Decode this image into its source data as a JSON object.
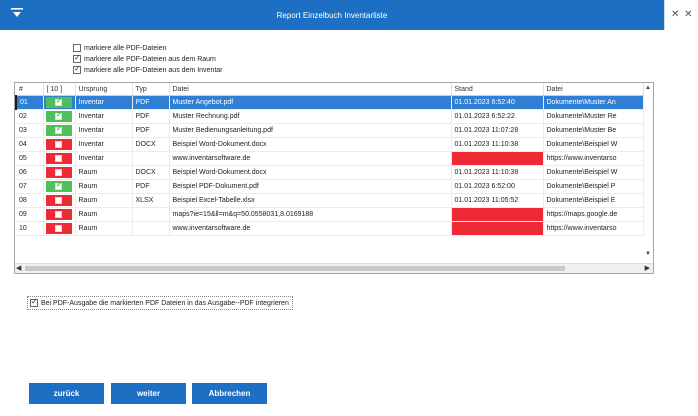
{
  "window": {
    "title": "Report Einzelbuch Inventarliste",
    "close_glyphs": "✕ ✕"
  },
  "options": {
    "mark_all_pdf": "markiere alle PDF-Dateien",
    "mark_all_pdf_room": "markiere alle PDF-Dateien aus dem Raum",
    "mark_all_pdf_inventory": "markiere alle PDF-Dateien aus dem Inventar"
  },
  "table": {
    "columns": [
      "#",
      "[ 10 ]",
      "Ursprung",
      "Typ",
      "Datei",
      "Stand",
      "Datei"
    ],
    "rows": [
      {
        "num": "01",
        "checked": true,
        "ursprung": "Inventar",
        "typ": "PDF",
        "datei": "Muster Angebot.pdf",
        "stand": "01.01.2023  6:52:40",
        "stand_missing": false,
        "pfad": "Dokumente\\Muster An"
      },
      {
        "num": "02",
        "checked": true,
        "ursprung": "Inventar",
        "typ": "PDF",
        "datei": "Muster Rechnung.pdf",
        "stand": "01.01.2023  6:52:22",
        "stand_missing": false,
        "pfad": "Dokumente\\Muster Re"
      },
      {
        "num": "03",
        "checked": true,
        "ursprung": "Inventar",
        "typ": "PDF",
        "datei": "Muster Bedienungsanleitung.pdf",
        "stand": "01.01.2023 11:07:28",
        "stand_missing": false,
        "pfad": "Dokumente\\Muster Be"
      },
      {
        "num": "04",
        "checked": false,
        "ursprung": "Inventar",
        "typ": "DOCX",
        "datei": "Beispiel Word-Dokument.docx",
        "stand": "01.01.2023 11:10:38",
        "stand_missing": false,
        "pfad": "Dokumente\\Beispiel W"
      },
      {
        "num": "05",
        "checked": false,
        "ursprung": "Inventar",
        "typ": "",
        "datei": "www.inventarsoftware.de",
        "stand": "",
        "stand_missing": true,
        "pfad": "https://www.inventarso"
      },
      {
        "num": "06",
        "checked": false,
        "ursprung": "Raum",
        "typ": "DOCX",
        "datei": "Beispiel Word-Dokument.docx",
        "stand": "01.01.2023 11:10:38",
        "stand_missing": false,
        "pfad": "Dokumente\\Beispiel W"
      },
      {
        "num": "07",
        "checked": true,
        "ursprung": "Raum",
        "typ": "PDF",
        "datei": "Beispiel PDF-Dokument.pdf",
        "stand": "01.01.2023  6:52:00",
        "stand_missing": false,
        "pfad": "Dokumente\\Beispiel P"
      },
      {
        "num": "08",
        "checked": false,
        "ursprung": "Raum",
        "typ": "XLSX",
        "datei": "Beispiel Excel-Tabelle.xlsx",
        "stand": "01.01.2023 11:05:52",
        "stand_missing": false,
        "pfad": "Dokumente\\Beispiel E"
      },
      {
        "num": "09",
        "checked": false,
        "ursprung": "Raum",
        "typ": "",
        "datei": "maps?ie=15&ll=m&q=50.0558031,8.0169188",
        "stand": "",
        "stand_missing": true,
        "pfad": "https://maps.google.de"
      },
      {
        "num": "10",
        "checked": false,
        "ursprung": "Raum",
        "typ": "",
        "datei": "www.inventarsoftware.de",
        "stand": "",
        "stand_missing": true,
        "pfad": "https://www.inventarso"
      }
    ],
    "selected_row": 0
  },
  "pdf_integrate_label": "Bei PDF-Ausgabe die markierten PDF Dateien in das Ausgabe--PDF integrieren",
  "buttons": {
    "back": "zurück",
    "next": "weiter",
    "cancel": "Abbrechen"
  },
  "colors": {
    "accent": "#1c6fc2",
    "selected_row": "#2f7fd4",
    "checked_flag": "#4fbf5a",
    "unchecked_flag": "#ee2a35",
    "missing_stand": "#ee2a35"
  },
  "icons": {
    "menu": "chevron-down-icon",
    "close": "close-icon"
  }
}
